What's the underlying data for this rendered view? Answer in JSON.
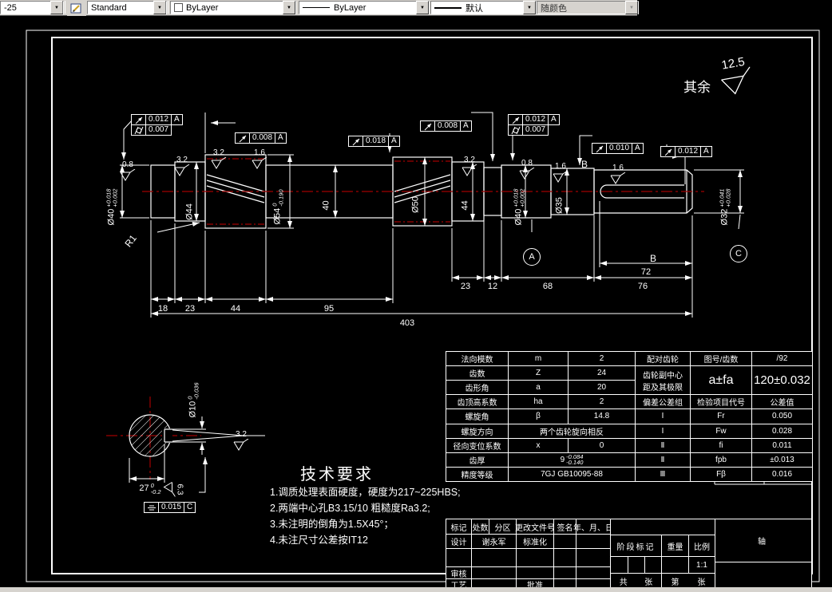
{
  "toolbar": {
    "dim_style": "-25",
    "text_style": "Standard",
    "color": "ByLayer",
    "linetype": "ByLayer",
    "lineweight": "默认",
    "plotstyle": "随颜色"
  },
  "colors": {
    "canvas": "#000000",
    "line": "#ffffff",
    "centerline": "#a00000",
    "toolbar_bg": "#d6d3ce"
  },
  "surface_note": {
    "prefix": "其余",
    "value": "12.5"
  },
  "roughness": {
    "r1": "0.8",
    "r2": "3.2",
    "r3": "3.2",
    "r4": "1.6",
    "r5": "3.2",
    "r6": "0.8",
    "r7": "1.6",
    "r8": "1.6",
    "r9": "3.2",
    "r10": "6.3"
  },
  "fcf": {
    "f1": {
      "v": "0.012",
      "d": "A",
      "v2": "0.007"
    },
    "f2": {
      "v": "0.008",
      "d": "A"
    },
    "f3": {
      "v": "0.018",
      "d": "A"
    },
    "f4": {
      "v": "0.008",
      "d": "A"
    },
    "f5": {
      "v": "0.012",
      "d": "A",
      "v2": "0.007"
    },
    "f6": {
      "v": "0.010",
      "d": "A"
    },
    "f7": {
      "v": "0.012",
      "d": "A"
    },
    "f8": {
      "v": "0.015",
      "d": "C"
    }
  },
  "datums": {
    "a": "A",
    "b": "B",
    "c": "C"
  },
  "labels": {
    "r1": "R1"
  },
  "lengths": {
    "l18": "18",
    "l23a": "23",
    "l44": "44",
    "l95": "95",
    "l403": "403",
    "l23b": "23",
    "l12": "12",
    "l68": "68",
    "l76": "76",
    "l72": "72"
  },
  "diameters": {
    "d40L": {
      "main": "Ø40",
      "sup": "+0.018",
      "sub": "+0.002"
    },
    "d44L": {
      "main": "Ø44"
    },
    "d54": {
      "main": "Ø54",
      "sup": "0",
      "sub": "-0.190"
    },
    "d40m": {
      "main": "40"
    },
    "d50": {
      "main": "Ø50"
    },
    "d44R": {
      "main": "44"
    },
    "d40R": {
      "main": "Ø40",
      "sup": "+0.018",
      "sub": "+0.002"
    },
    "d35": {
      "main": "Ø35"
    },
    "d32": {
      "main": "Ø32",
      "sup": "+0.041",
      "sub": "+0.028"
    },
    "d10": {
      "main": "Ø10",
      "sup": "0",
      "sub": "-0.036"
    },
    "d27": {
      "main": "27",
      "sup": "0",
      "sub": "-0.2"
    }
  },
  "techreq": {
    "title": "技术要求",
    "items": [
      "1.调质处理表面硬度，硬度为217~225HBS;",
      "2.两端中心孔B3.15/10 粗糙度Ra3.2;",
      "3.未注明的倒角为1.5X45°；",
      "4.未注尺寸公差按IT12"
    ]
  },
  "gear_table": {
    "left_rows": [
      {
        "label": "法向模数",
        "sym": "m",
        "val": "2"
      },
      {
        "label": "齿数",
        "sym": "Z",
        "val": "24"
      },
      {
        "label": "齿形角",
        "sym": "a",
        "val": "20"
      },
      {
        "label": "齿顶高系数",
        "sym": "ha",
        "val": "2"
      },
      {
        "label": "螺旋角",
        "sym": "β",
        "val": "14.8"
      }
    ],
    "helix_dir": {
      "label": "螺旋方向",
      "val": "两个齿轮旋向相反"
    },
    "shift": {
      "label": "径向变位系数",
      "sym": "x",
      "val": "0"
    },
    "thickness": {
      "label": "齿厚",
      "main": "9",
      "sup": "-0.084",
      "sub": "-0.140"
    },
    "precision": {
      "label": "精度等级",
      "val": "7GJ GB10095-88"
    },
    "right": {
      "mate": {
        "label": "配对齿轮",
        "mid": "图号/齿数",
        "val": "/92"
      },
      "center": {
        "label1": "齿轮副中心",
        "label2": "距及其极限",
        "mid": "a±fa",
        "val": "120±0.032"
      },
      "header": {
        "label": "偏差公差组",
        "mid": "检验项目代号",
        "val": "公差值"
      },
      "rows": [
        {
          "g": "Ⅰ",
          "code": "Fr",
          "val": "0.050"
        },
        {
          "g": "Ⅰ",
          "code": "Fw",
          "val": "0.028"
        },
        {
          "g": "Ⅱ",
          "code": "fi",
          "val": "0.011"
        },
        {
          "g": "Ⅱ",
          "code": "fpb",
          "val": "±0.013"
        },
        {
          "g": "Ⅲ",
          "code": "Fβ",
          "val": "0.016"
        }
      ]
    }
  },
  "title_block": {
    "row1": [
      "标记",
      "处数",
      "分区",
      "更改文件号",
      "签名",
      "年、月、日"
    ],
    "design": "设计",
    "designer": "谢永军",
    "standardization": "标准化",
    "review": "审核",
    "process": "工艺",
    "approve": "批准",
    "stage": "阶段标记",
    "weight": "重量",
    "scale_label": "比例",
    "scale": "1:1",
    "total_label": "共",
    "sheet1": "张",
    "no_label": "第",
    "sheet2": "张",
    "part_name": "轴"
  }
}
